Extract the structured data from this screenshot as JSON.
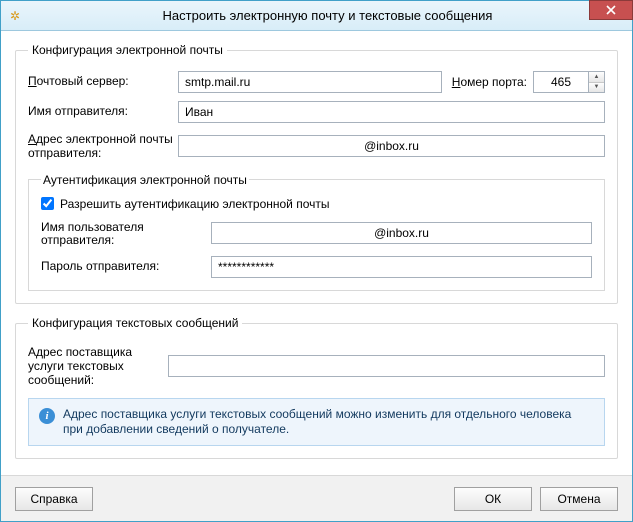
{
  "window": {
    "title": "Настроить электронную почту и текстовые сообщения"
  },
  "email_config": {
    "legend": "Конфигурация электронной почты",
    "server_label": "Почтовый сервер:",
    "server_value": "smtp.mail.ru",
    "port_label": "Номер порта:",
    "port_value": "465",
    "sender_name_label": "Имя отправителя:",
    "sender_name_value": "Иван",
    "sender_addr_label": "Адрес электронной почты отправителя:",
    "sender_addr_value": "@inbox.ru"
  },
  "auth": {
    "legend": "Аутентификация электронной почты",
    "enable_label": "Разрешить аутентификацию электронной почты",
    "enable_checked": true,
    "user_label": "Имя пользователя отправителя:",
    "user_value": "@inbox.ru",
    "pw_label": "Пароль отправителя:",
    "pw_value": "************"
  },
  "text_config": {
    "legend": "Конфигурация текстовых сообщений",
    "provider_label": "Адрес поставщика услуги текстовых сообщений:",
    "provider_value": "",
    "info_text": "Адрес поставщика услуги текстовых сообщений можно изменить для отдельного человека при добавлении сведений о получателе."
  },
  "buttons": {
    "help": "Справка",
    "ok": "ОК",
    "cancel": "Отмена"
  }
}
